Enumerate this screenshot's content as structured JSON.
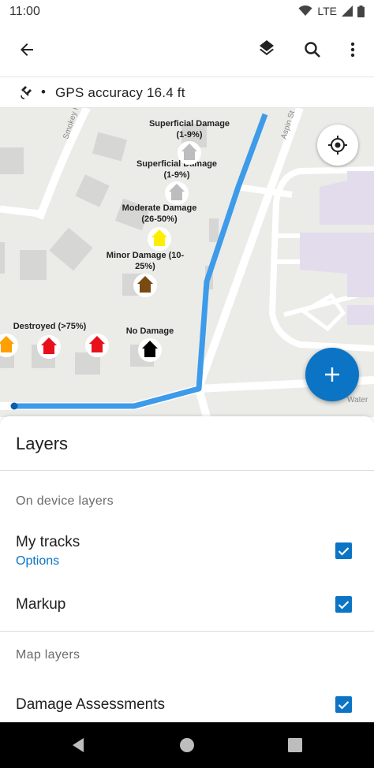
{
  "status_bar": {
    "time": "11:00",
    "network": "LTE",
    "icons": [
      "wifi-icon",
      "signal-icon",
      "battery-icon"
    ]
  },
  "app_bar": {
    "icons": [
      "back-arrow-icon",
      "layers-icon",
      "search-icon",
      "more-vert-icon"
    ]
  },
  "gps": {
    "accuracy_text": "GPS accuracy 16.4 ft",
    "separator": "•",
    "icon": "gps-satellite-icon"
  },
  "map": {
    "streets": [
      "Smokey Rd",
      "Aspin St",
      "Water"
    ],
    "legend": [
      {
        "line1": "Superficial Damage",
        "line2": "(1-9%)",
        "color": "#bdbdbd"
      },
      {
        "line1": "Superficial Damage",
        "line2": "(1-9%)",
        "color": "#bdbdbd"
      },
      {
        "line1": "Moderate Damage",
        "line2": "(26-50%)",
        "color": "#ffee00"
      },
      {
        "line1": "Minor Damage (10-",
        "line2": "25%)",
        "color": "#7a4a12"
      },
      {
        "line1": "Destroyed (>75%)",
        "line2": "",
        "color": "#e8101b"
      },
      {
        "line1": "No Damage",
        "line2": "",
        "color": "#000000"
      }
    ],
    "colors": {
      "track": "#3d9be9",
      "fab": "#0b74c4",
      "partial_marker": "#ffa000"
    }
  },
  "layers": {
    "title": "Layers",
    "sections": [
      {
        "label": "On device layers",
        "items": [
          {
            "label": "My tracks",
            "sub": "Options",
            "checked": true
          },
          {
            "label": "Markup",
            "checked": true
          }
        ]
      },
      {
        "label": "Map layers",
        "items": [
          {
            "label": "Damage Assessments",
            "checked": true
          }
        ]
      }
    ]
  },
  "nav": {
    "icons": [
      "back-triangle-icon",
      "home-circle-icon",
      "recents-square-icon"
    ]
  }
}
